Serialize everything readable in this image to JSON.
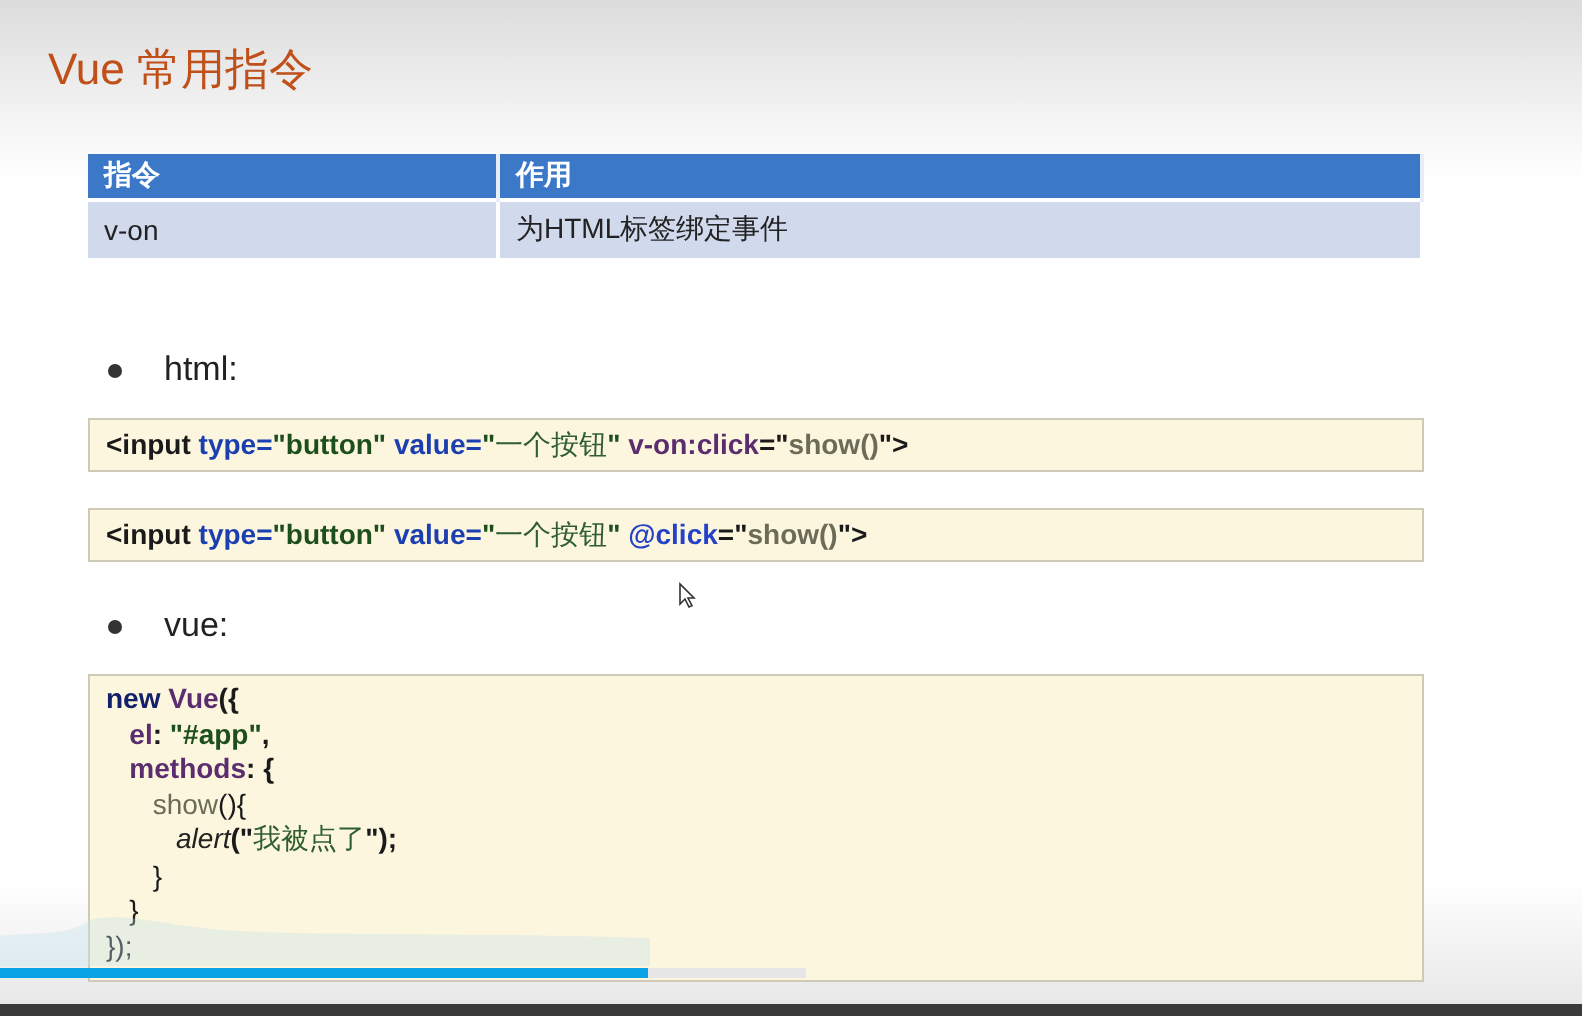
{
  "slide": {
    "title": "Vue 常用指令",
    "table": {
      "columns": [
        "指令",
        "作用"
      ],
      "rows": [
        [
          "v-on",
          "为HTML标签绑定事件"
        ]
      ]
    },
    "bullets": [
      {
        "label": "html:",
        "blocks": [
          [
            [
              {
                "text": "<input ",
                "kind": "punct"
              },
              {
                "text": "type=",
                "kind": "attr"
              },
              {
                "text": "\"button\" ",
                "kind": "string"
              },
              {
                "text": "value=",
                "kind": "attr"
              },
              {
                "text": "\"",
                "kind": "string"
              },
              {
                "text": "一个按钮",
                "kind": "cjk"
              },
              {
                "text": "\" ",
                "kind": "string"
              },
              {
                "text": "v-on:click",
                "kind": "directive"
              },
              {
                "text": "=\"",
                "kind": "punct"
              },
              {
                "text": "show()",
                "kind": "func"
              },
              {
                "text": "\">",
                "kind": "punct"
              }
            ]
          ],
          [
            [
              {
                "text": "<input ",
                "kind": "punct"
              },
              {
                "text": "type=",
                "kind": "attr"
              },
              {
                "text": "\"button\" ",
                "kind": "string"
              },
              {
                "text": "value=",
                "kind": "attr"
              },
              {
                "text": "\"",
                "kind": "string"
              },
              {
                "text": "一个按钮",
                "kind": "cjk"
              },
              {
                "text": "\" ",
                "kind": "string"
              },
              {
                "text": "@click",
                "kind": "event"
              },
              {
                "text": "=\"",
                "kind": "punct"
              },
              {
                "text": "show()",
                "kind": "func"
              },
              {
                "text": "\">",
                "kind": "punct"
              }
            ]
          ]
        ]
      },
      {
        "label": "vue:",
        "blocks": [
          [
            [
              {
                "text": "new ",
                "kind": "keyword"
              },
              {
                "text": "Vue",
                "kind": "key"
              },
              {
                "text": "({",
                "kind": "punct"
              }
            ],
            [
              {
                "text": "   el",
                "kind": "key"
              },
              {
                "text": ": ",
                "kind": "punct"
              },
              {
                "text": "\"#app\"",
                "kind": "string"
              },
              {
                "text": ",",
                "kind": "punct"
              }
            ],
            [
              {
                "text": "   methods",
                "kind": "key"
              },
              {
                "text": ": {",
                "kind": "punct"
              }
            ],
            [
              {
                "text": "      show",
                "kind": "func"
              },
              {
                "text": "(){",
                "kind": "plain"
              }
            ],
            [
              {
                "text": "         alert",
                "kind": "italic"
              },
              {
                "text": "(\"",
                "kind": "punct"
              },
              {
                "text": "我被点了",
                "kind": "cjk"
              },
              {
                "text": "\");",
                "kind": "punct"
              }
            ],
            [
              {
                "text": "      }",
                "kind": "plain"
              }
            ],
            [
              {
                "text": "   }",
                "kind": "plain"
              }
            ],
            [
              {
                "text": "});",
                "kind": "plain"
              }
            ]
          ]
        ]
      }
    ]
  },
  "player": {
    "progress": {
      "level": 0.41
    }
  }
}
